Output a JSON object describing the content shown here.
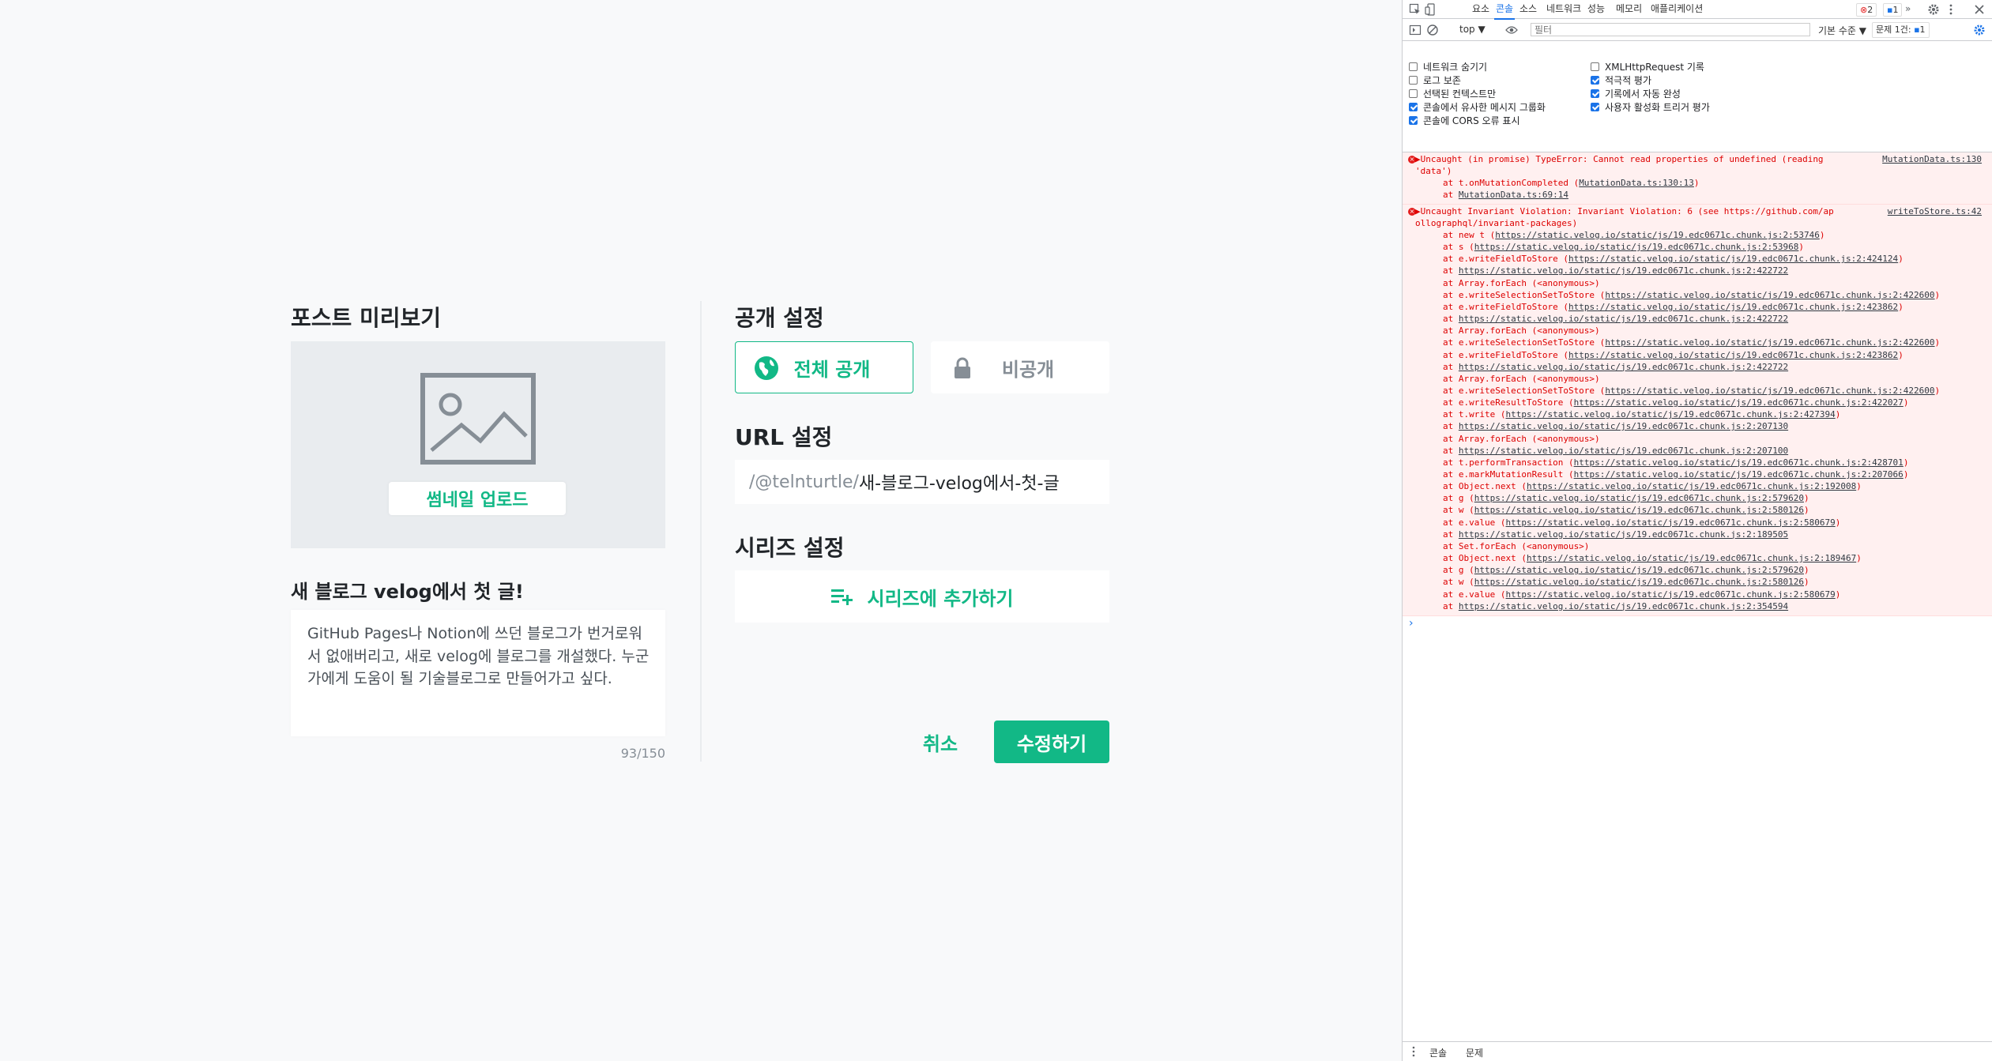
{
  "publish": {
    "preview_heading": "포스트 미리보기",
    "thumbnail_upload_label": "썸네일 업로드",
    "post_title": "새 블로그 velog에서 첫 글!",
    "description": "GitHub Pages나 Notion에 쓰던 블로그가 번거로워서 없애버리고, 새로 velog에 블로그를 개설했다. 누군가에게 도움이 될 기술블로그로 만들어가고 싶다.",
    "description_count": "93/150",
    "visibility_heading": "공개 설정",
    "visibility_public": "전체 공개",
    "visibility_private": "비공개",
    "url_heading": "URL 설정",
    "url_prefix": "/@telnturtle/",
    "url_slug": "새-블로그-velog에서-첫-글",
    "series_heading": "시리즈 설정",
    "series_add_label": "시리즈에 추가하기",
    "cancel_label": "취소",
    "submit_label": "수정하기",
    "accent_color": "#12b886"
  },
  "devtools": {
    "tabs": [
      "요소",
      "콘솔",
      "소스",
      "네트워크",
      "성능",
      "메모리",
      "애플리케이션"
    ],
    "active_tab": "콘솔",
    "more_tabs": "»",
    "error_count": "2",
    "issue_count": "1",
    "context": "top ▼",
    "filter_placeholder": "필터",
    "level": "기본 수준 ▼",
    "issues_label": "문제 1건:",
    "issues_badge": "1",
    "settings": [
      {
        "label": "네트워크 숨기기",
        "checked": false
      },
      {
        "label": "XMLHttpRequest 기록",
        "checked": false
      },
      {
        "label": "로그 보존",
        "checked": false
      },
      {
        "label": "적극적 평가",
        "checked": true
      },
      {
        "label": "선택된 컨텍스트만",
        "checked": false
      },
      {
        "label": "기록에서 자동 완성",
        "checked": true
      },
      {
        "label": "콘솔에서 유사한 메시지 그룹화",
        "checked": true
      },
      {
        "label": "사용자 활성화 트리거 평가",
        "checked": true
      },
      {
        "label": "콘솔에 CORS 오류 표시",
        "checked": true
      }
    ],
    "error1": {
      "line1": "▶Uncaught (in promise) TypeError: Cannot read properties of undefined (reading",
      "line2": "'data')",
      "source": "MutationData.ts:130",
      "stack": [
        {
          "text": "at t.onMutationCompleted (",
          "link": "MutationData.ts:130:13",
          "tail": ")"
        },
        {
          "text": "at ",
          "link": "MutationData.ts:69:14",
          "tail": ""
        }
      ]
    },
    "error2": {
      "line1": "▶Uncaught Invariant Violation: Invariant Violation: 6 (see https://github.com/ap",
      "line2": "ollographql/invariant-packages)",
      "source": "writeToStore.ts:42",
      "stack": [
        {
          "text": "at new t (",
          "link": "https://static.velog.io/static/js/19.edc0671c.chunk.js:2:53746",
          "tail": ")"
        },
        {
          "text": "at s (",
          "link": "https://static.velog.io/static/js/19.edc0671c.chunk.js:2:53968",
          "tail": ")"
        },
        {
          "text": "at e.writeFieldToStore (",
          "link": "https://static.velog.io/static/js/19.edc0671c.chunk.js:2:424124",
          "tail": ")"
        },
        {
          "text": "at ",
          "link": "https://static.velog.io/static/js/19.edc0671c.chunk.js:2:422722",
          "tail": ""
        },
        {
          "text": "at Array.forEach (<anonymous>)",
          "link": "",
          "tail": ""
        },
        {
          "text": "at e.writeSelectionSetToStore (",
          "link": "https://static.velog.io/static/js/19.edc0671c.chunk.js:2:422600",
          "tail": ")"
        },
        {
          "text": "at e.writeFieldToStore (",
          "link": "https://static.velog.io/static/js/19.edc0671c.chunk.js:2:423862",
          "tail": ")"
        },
        {
          "text": "at ",
          "link": "https://static.velog.io/static/js/19.edc0671c.chunk.js:2:422722",
          "tail": ""
        },
        {
          "text": "at Array.forEach (<anonymous>)",
          "link": "",
          "tail": ""
        },
        {
          "text": "at e.writeSelectionSetToStore (",
          "link": "https://static.velog.io/static/js/19.edc0671c.chunk.js:2:422600",
          "tail": ")"
        },
        {
          "text": "at e.writeFieldToStore (",
          "link": "https://static.velog.io/static/js/19.edc0671c.chunk.js:2:423862",
          "tail": ")"
        },
        {
          "text": "at ",
          "link": "https://static.velog.io/static/js/19.edc0671c.chunk.js:2:422722",
          "tail": ""
        },
        {
          "text": "at Array.forEach (<anonymous>)",
          "link": "",
          "tail": ""
        },
        {
          "text": "at e.writeSelectionSetToStore (",
          "link": "https://static.velog.io/static/js/19.edc0671c.chunk.js:2:422600",
          "tail": ")"
        },
        {
          "text": "at e.writeResultToStore (",
          "link": "https://static.velog.io/static/js/19.edc0671c.chunk.js:2:422027",
          "tail": ")"
        },
        {
          "text": "at t.write (",
          "link": "https://static.velog.io/static/js/19.edc0671c.chunk.js:2:427394",
          "tail": ")"
        },
        {
          "text": "at ",
          "link": "https://static.velog.io/static/js/19.edc0671c.chunk.js:2:207130",
          "tail": ""
        },
        {
          "text": "at Array.forEach (<anonymous>)",
          "link": "",
          "tail": ""
        },
        {
          "text": "at ",
          "link": "https://static.velog.io/static/js/19.edc0671c.chunk.js:2:207100",
          "tail": ""
        },
        {
          "text": "at t.performTransaction (",
          "link": "https://static.velog.io/static/js/19.edc0671c.chunk.js:2:428701",
          "tail": ")"
        },
        {
          "text": "at e.markMutationResult (",
          "link": "https://static.velog.io/static/js/19.edc0671c.chunk.js:2:207066",
          "tail": ")"
        },
        {
          "text": "at Object.next (",
          "link": "https://static.velog.io/static/js/19.edc0671c.chunk.js:2:192008",
          "tail": ")"
        },
        {
          "text": "at g (",
          "link": "https://static.velog.io/static/js/19.edc0671c.chunk.js:2:579620",
          "tail": ")"
        },
        {
          "text": "at w (",
          "link": "https://static.velog.io/static/js/19.edc0671c.chunk.js:2:580126",
          "tail": ")"
        },
        {
          "text": "at e.value (",
          "link": "https://static.velog.io/static/js/19.edc0671c.chunk.js:2:580679",
          "tail": ")"
        },
        {
          "text": "at ",
          "link": "https://static.velog.io/static/js/19.edc0671c.chunk.js:2:189505",
          "tail": ""
        },
        {
          "text": "at Set.forEach (<anonymous>)",
          "link": "",
          "tail": ""
        },
        {
          "text": "at Object.next (",
          "link": "https://static.velog.io/static/js/19.edc0671c.chunk.js:2:189467",
          "tail": ")"
        },
        {
          "text": "at g (",
          "link": "https://static.velog.io/static/js/19.edc0671c.chunk.js:2:579620",
          "tail": ")"
        },
        {
          "text": "at w (",
          "link": "https://static.velog.io/static/js/19.edc0671c.chunk.js:2:580126",
          "tail": ")"
        },
        {
          "text": "at e.value (",
          "link": "https://static.velog.io/static/js/19.edc0671c.chunk.js:2:580679",
          "tail": ")"
        },
        {
          "text": "at ",
          "link": "https://static.velog.io/static/js/19.edc0671c.chunk.js:2:354594",
          "tail": ""
        }
      ]
    },
    "prompt": "›",
    "drawer_tabs": [
      "콘솔",
      "문제"
    ]
  }
}
